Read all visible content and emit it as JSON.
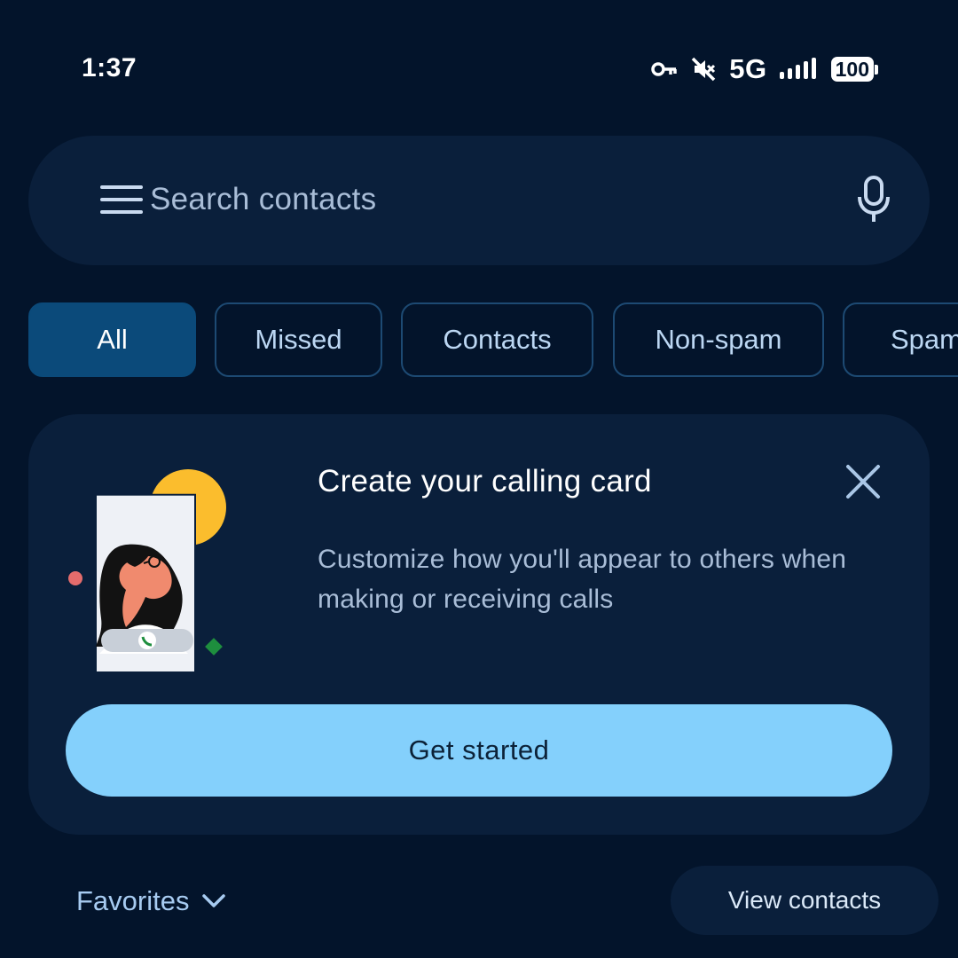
{
  "status_bar": {
    "time": "1:37",
    "network": "5G",
    "battery": "100",
    "icons": [
      "vpn-key-icon",
      "mute-icon",
      "signal-icon",
      "battery-icon"
    ]
  },
  "search": {
    "placeholder": "Search contacts",
    "icons": [
      "menu-icon",
      "mic-icon"
    ]
  },
  "filters": {
    "chips": [
      {
        "label": "All",
        "active": true
      },
      {
        "label": "Missed",
        "active": false
      },
      {
        "label": "Contacts",
        "active": false
      },
      {
        "label": "Non-spam",
        "active": false
      },
      {
        "label": "Spam",
        "active": false
      }
    ]
  },
  "card": {
    "title": "Create your calling card",
    "description": "Customize how you'll appear to others when making or receiving calls",
    "cta_label": "Get started",
    "close_icon": "close-icon"
  },
  "footer": {
    "favorites_label": "Favorites",
    "view_contacts_label": "View contacts"
  },
  "colors": {
    "background": "#03142b",
    "surface": "#0a1f3b",
    "accent": "#84d0fc",
    "chip_active": "#0b4a7a",
    "chip_border": "#1d4a73"
  }
}
